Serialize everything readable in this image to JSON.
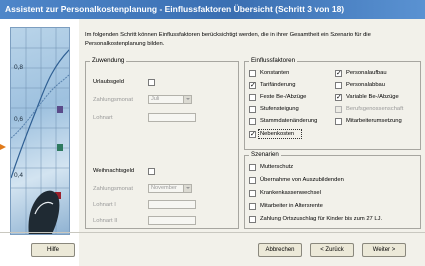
{
  "window": {
    "title": "Assistent zur Personalkostenplanung - Einflussfaktoren Übersicht (Schritt 3 von 18)"
  },
  "intro": "Im folgenden Schritt können Einflussfaktoren berücksichtigt werden, die in ihrer Gesamtheit ein Szenario für die Personalkostenplanung bilden.",
  "zuwendung": {
    "title": "Zuwendung",
    "urlaubsgeld_label": "Urlaubsgeld",
    "zahlungsmonat_label": "Zahlungsmonat",
    "zahlungsmonat_value": "Juli",
    "lohnart_label": "Lohnart",
    "weihnachtsgeld_label": "Weihnachtsgeld",
    "zahlungsmonat2_label": "Zahlungsmonat",
    "zahlungsmonat2_value": "November",
    "lohnart1_label": "Lohnart I",
    "lohnart2_label": "Lohnart II"
  },
  "einflussfaktoren": {
    "title": "Einflussfaktoren",
    "left": [
      {
        "label": "Konstanten",
        "checked": false,
        "disabled": false
      },
      {
        "label": "Tarifänderung",
        "checked": true,
        "disabled": false
      },
      {
        "label": "Feste Be-/Abzüge",
        "checked": false,
        "disabled": false
      },
      {
        "label": "Stufensteigung",
        "checked": false,
        "disabled": false
      },
      {
        "label": "Stammdatenänderung",
        "checked": false,
        "disabled": false
      },
      {
        "label": "Nebenkosten",
        "checked": true,
        "disabled": false
      }
    ],
    "right": [
      {
        "label": "Personalaufbau",
        "checked": true,
        "disabled": false
      },
      {
        "label": "Personalabbau",
        "checked": false,
        "disabled": false
      },
      {
        "label": "Variable Be-/Abzüge",
        "checked": true,
        "disabled": false
      },
      {
        "label": "Berufsgenossenschaft",
        "checked": false,
        "disabled": true
      },
      {
        "label": "Mitarbeiterumsetzung",
        "checked": false,
        "disabled": false
      }
    ]
  },
  "szenarien": {
    "title": "Szenarien",
    "items": [
      {
        "label": "Mutterschutz",
        "checked": false
      },
      {
        "label": "Übernahme von Auszubildenden",
        "checked": false
      },
      {
        "label": "Krankenkassenwechsel",
        "checked": false
      },
      {
        "label": "Mitarbeiter in Altersrente",
        "checked": false
      },
      {
        "label": "Zahlung Ortszuschlag für Kinder bis zum 27 LJ.",
        "checked": false
      }
    ]
  },
  "buttons": {
    "help": "Hilfe",
    "cancel": "Abbrechen",
    "back": "< Zurück",
    "next": "Weiter >"
  },
  "sidepanel": {
    "values": [
      "0,8",
      "0,6",
      "0,4"
    ]
  },
  "colors": {
    "titlebar": "#3a6fb2",
    "check": "#000000",
    "arrow": "#e07a1a"
  }
}
